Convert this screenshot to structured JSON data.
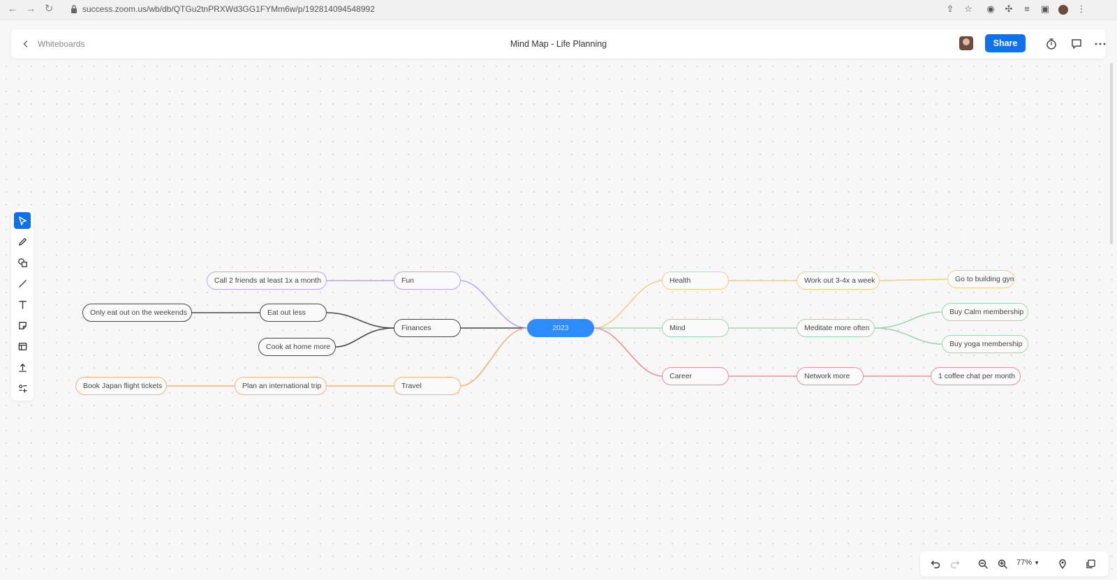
{
  "browser": {
    "url": "success.zoom.us/wb/db/QTGu2tnPRXWd3GG1FYMm6w/p/192814094548992"
  },
  "header": {
    "back_label": "Whiteboards",
    "title": "Mind Map - Life Planning",
    "share_label": "Share"
  },
  "mindmap": {
    "center": "2023",
    "nodes": {
      "fun": "Fun",
      "finances": "Finances",
      "travel": "Travel",
      "call_friends": "Call 2 friends at least 1x a month",
      "eat_out_less": "Eat out less",
      "cook_home": "Cook at home more",
      "weekends": "Only eat out on the weekends",
      "intl_trip": "Plan an international trip",
      "japan": "Book Japan flight tickets",
      "health": "Health",
      "mind": "Mind",
      "career": "Career",
      "workout": "Work out 3-4x a week",
      "gym": "Go to building gym",
      "meditate": "Meditate more often",
      "calm": "Buy Calm membership",
      "yoga": "Buy yoga membership",
      "network": "Network more",
      "coffee": "1 coffee chat per month"
    }
  },
  "colors": {
    "accent": "#0e72ed",
    "center": "#2d8cff",
    "fun": "#b9a6ef",
    "finances": "#444444",
    "travel": "#f4b27c",
    "health": "#f7ce7d",
    "mind": "#9fd6b3",
    "career": "#e8909c"
  },
  "toolbar": {
    "tools": [
      "select-icon",
      "pen-icon",
      "shapes-icon",
      "line-icon",
      "text-icon",
      "sticky-note-icon",
      "template-icon",
      "upload-icon",
      "more-tools-icon"
    ],
    "active_tool": "select-icon"
  },
  "bottom": {
    "zoom": "77%"
  }
}
